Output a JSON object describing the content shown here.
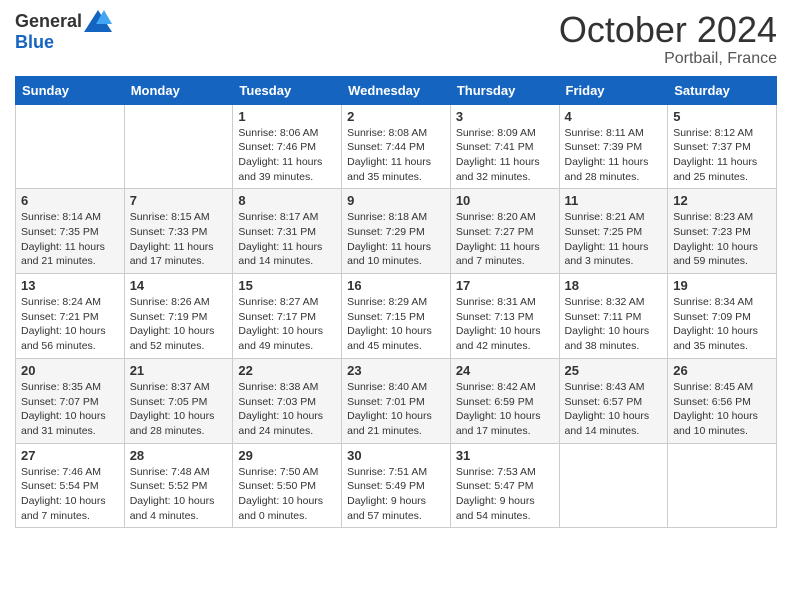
{
  "header": {
    "logo_general": "General",
    "logo_blue": "Blue",
    "month": "October 2024",
    "location": "Portbail, France"
  },
  "weekdays": [
    "Sunday",
    "Monday",
    "Tuesday",
    "Wednesday",
    "Thursday",
    "Friday",
    "Saturday"
  ],
  "weeks": [
    [
      {
        "day": "",
        "info": ""
      },
      {
        "day": "",
        "info": ""
      },
      {
        "day": "1",
        "info": "Sunrise: 8:06 AM\nSunset: 7:46 PM\nDaylight: 11 hours and 39 minutes."
      },
      {
        "day": "2",
        "info": "Sunrise: 8:08 AM\nSunset: 7:44 PM\nDaylight: 11 hours and 35 minutes."
      },
      {
        "day": "3",
        "info": "Sunrise: 8:09 AM\nSunset: 7:41 PM\nDaylight: 11 hours and 32 minutes."
      },
      {
        "day": "4",
        "info": "Sunrise: 8:11 AM\nSunset: 7:39 PM\nDaylight: 11 hours and 28 minutes."
      },
      {
        "day": "5",
        "info": "Sunrise: 8:12 AM\nSunset: 7:37 PM\nDaylight: 11 hours and 25 minutes."
      }
    ],
    [
      {
        "day": "6",
        "info": "Sunrise: 8:14 AM\nSunset: 7:35 PM\nDaylight: 11 hours and 21 minutes."
      },
      {
        "day": "7",
        "info": "Sunrise: 8:15 AM\nSunset: 7:33 PM\nDaylight: 11 hours and 17 minutes."
      },
      {
        "day": "8",
        "info": "Sunrise: 8:17 AM\nSunset: 7:31 PM\nDaylight: 11 hours and 14 minutes."
      },
      {
        "day": "9",
        "info": "Sunrise: 8:18 AM\nSunset: 7:29 PM\nDaylight: 11 hours and 10 minutes."
      },
      {
        "day": "10",
        "info": "Sunrise: 8:20 AM\nSunset: 7:27 PM\nDaylight: 11 hours and 7 minutes."
      },
      {
        "day": "11",
        "info": "Sunrise: 8:21 AM\nSunset: 7:25 PM\nDaylight: 11 hours and 3 minutes."
      },
      {
        "day": "12",
        "info": "Sunrise: 8:23 AM\nSunset: 7:23 PM\nDaylight: 10 hours and 59 minutes."
      }
    ],
    [
      {
        "day": "13",
        "info": "Sunrise: 8:24 AM\nSunset: 7:21 PM\nDaylight: 10 hours and 56 minutes."
      },
      {
        "day": "14",
        "info": "Sunrise: 8:26 AM\nSunset: 7:19 PM\nDaylight: 10 hours and 52 minutes."
      },
      {
        "day": "15",
        "info": "Sunrise: 8:27 AM\nSunset: 7:17 PM\nDaylight: 10 hours and 49 minutes."
      },
      {
        "day": "16",
        "info": "Sunrise: 8:29 AM\nSunset: 7:15 PM\nDaylight: 10 hours and 45 minutes."
      },
      {
        "day": "17",
        "info": "Sunrise: 8:31 AM\nSunset: 7:13 PM\nDaylight: 10 hours and 42 minutes."
      },
      {
        "day": "18",
        "info": "Sunrise: 8:32 AM\nSunset: 7:11 PM\nDaylight: 10 hours and 38 minutes."
      },
      {
        "day": "19",
        "info": "Sunrise: 8:34 AM\nSunset: 7:09 PM\nDaylight: 10 hours and 35 minutes."
      }
    ],
    [
      {
        "day": "20",
        "info": "Sunrise: 8:35 AM\nSunset: 7:07 PM\nDaylight: 10 hours and 31 minutes."
      },
      {
        "day": "21",
        "info": "Sunrise: 8:37 AM\nSunset: 7:05 PM\nDaylight: 10 hours and 28 minutes."
      },
      {
        "day": "22",
        "info": "Sunrise: 8:38 AM\nSunset: 7:03 PM\nDaylight: 10 hours and 24 minutes."
      },
      {
        "day": "23",
        "info": "Sunrise: 8:40 AM\nSunset: 7:01 PM\nDaylight: 10 hours and 21 minutes."
      },
      {
        "day": "24",
        "info": "Sunrise: 8:42 AM\nSunset: 6:59 PM\nDaylight: 10 hours and 17 minutes."
      },
      {
        "day": "25",
        "info": "Sunrise: 8:43 AM\nSunset: 6:57 PM\nDaylight: 10 hours and 14 minutes."
      },
      {
        "day": "26",
        "info": "Sunrise: 8:45 AM\nSunset: 6:56 PM\nDaylight: 10 hours and 10 minutes."
      }
    ],
    [
      {
        "day": "27",
        "info": "Sunrise: 7:46 AM\nSunset: 5:54 PM\nDaylight: 10 hours and 7 minutes."
      },
      {
        "day": "28",
        "info": "Sunrise: 7:48 AM\nSunset: 5:52 PM\nDaylight: 10 hours and 4 minutes."
      },
      {
        "day": "29",
        "info": "Sunrise: 7:50 AM\nSunset: 5:50 PM\nDaylight: 10 hours and 0 minutes."
      },
      {
        "day": "30",
        "info": "Sunrise: 7:51 AM\nSunset: 5:49 PM\nDaylight: 9 hours and 57 minutes."
      },
      {
        "day": "31",
        "info": "Sunrise: 7:53 AM\nSunset: 5:47 PM\nDaylight: 9 hours and 54 minutes."
      },
      {
        "day": "",
        "info": ""
      },
      {
        "day": "",
        "info": ""
      }
    ]
  ]
}
